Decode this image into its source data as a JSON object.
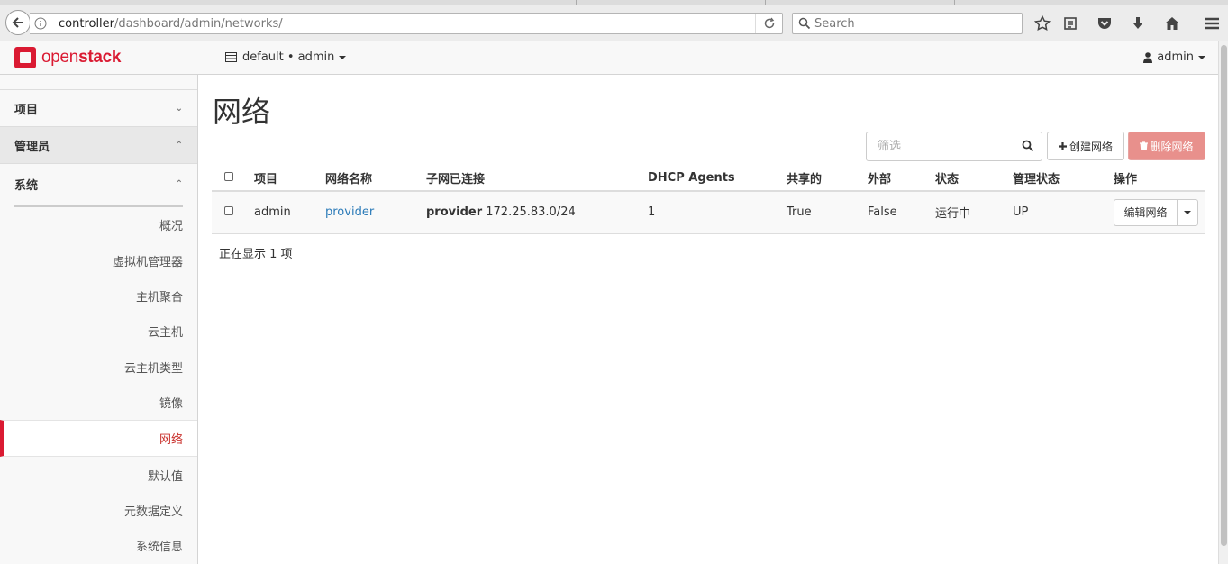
{
  "browser": {
    "url_host": "controller",
    "url_path": "/dashboard/admin/networks/",
    "search_placeholder": "Search"
  },
  "topnav": {
    "logo_light": "open",
    "logo_bold": "stack",
    "project": "default • admin",
    "user": "admin"
  },
  "sidebar": {
    "project_label": "项目",
    "admin_label": "管理员",
    "system_label": "系统",
    "items": [
      {
        "label": "概况"
      },
      {
        "label": "虚拟机管理器"
      },
      {
        "label": "主机聚合"
      },
      {
        "label": "云主机"
      },
      {
        "label": "云主机类型"
      },
      {
        "label": "镜像"
      },
      {
        "label": "网络"
      },
      {
        "label": "默认值"
      },
      {
        "label": "元数据定义"
      },
      {
        "label": "系统信息"
      }
    ],
    "active_item": "网络"
  },
  "main": {
    "title": "网络",
    "filter_placeholder": "筛选",
    "create_label": "创建网络",
    "delete_label": "删除网络",
    "columns": [
      "项目",
      "网络名称",
      "子网已连接",
      "DHCP Agents",
      "共享的",
      "外部",
      "状态",
      "管理状态",
      "操作"
    ],
    "rows": [
      {
        "project": "admin",
        "name": "provider",
        "subnet_name": "provider",
        "subnet_cidr": "172.25.83.0/24",
        "dhcp_agents": "1",
        "shared": "True",
        "external": "False",
        "status": "运行中",
        "admin_state": "UP",
        "action_label": "编辑网络"
      }
    ],
    "count_text": "正在显示 1 项"
  },
  "colors": {
    "brand_red": "#da1a32",
    "link_blue": "#2a7ab8",
    "danger_disabled": "#e8908c"
  }
}
